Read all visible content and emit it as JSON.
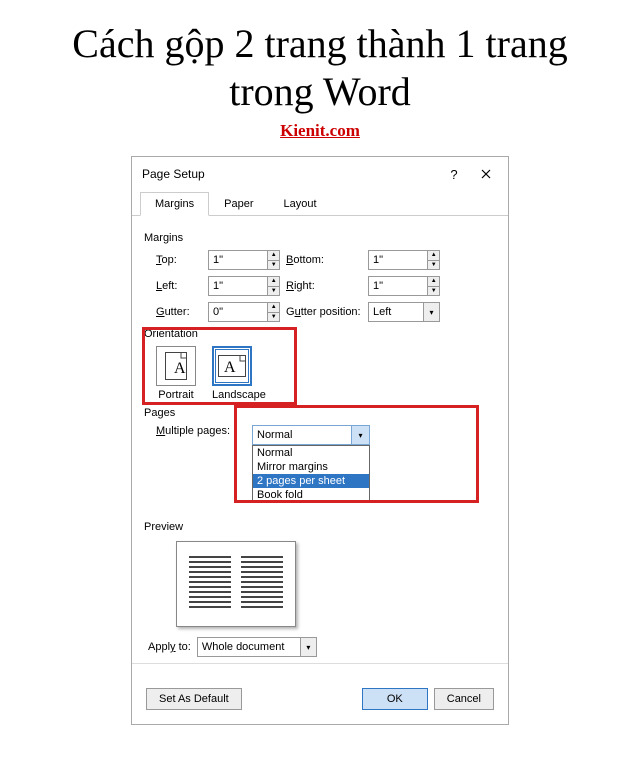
{
  "article": {
    "title": "Cách gộp 2 trang thành 1 trang trong Word",
    "site": "Kienit.com"
  },
  "dialog": {
    "title": "Page Setup",
    "help": "?",
    "tabs": [
      "Margins",
      "Paper",
      "Layout"
    ],
    "active_tab": 0,
    "margins": {
      "section": "Margins",
      "top_label": "Top:",
      "top_value": "1\"",
      "bottom_label": "Bottom:",
      "bottom_value": "1\"",
      "left_label": "Left:",
      "left_value": "1\"",
      "right_label": "Right:",
      "right_value": "1\"",
      "gutter_label": "Gutter:",
      "gutter_value": "0\"",
      "gutter_pos_label": "Gutter position:",
      "gutter_pos_value": "Left"
    },
    "orientation": {
      "section": "Orientation",
      "portrait": "Portrait",
      "landscape": "Landscape",
      "selected": "landscape"
    },
    "pages": {
      "section": "Pages",
      "label": "Multiple pages:",
      "value": "Normal",
      "options": [
        "Normal",
        "Mirror margins",
        "2 pages per sheet",
        "Book fold"
      ],
      "highlighted_index": 2
    },
    "preview": {
      "section": "Preview"
    },
    "apply": {
      "label": "Apply to:",
      "value": "Whole document"
    },
    "buttons": {
      "default": "Set As Default",
      "ok": "OK",
      "cancel": "Cancel"
    }
  }
}
